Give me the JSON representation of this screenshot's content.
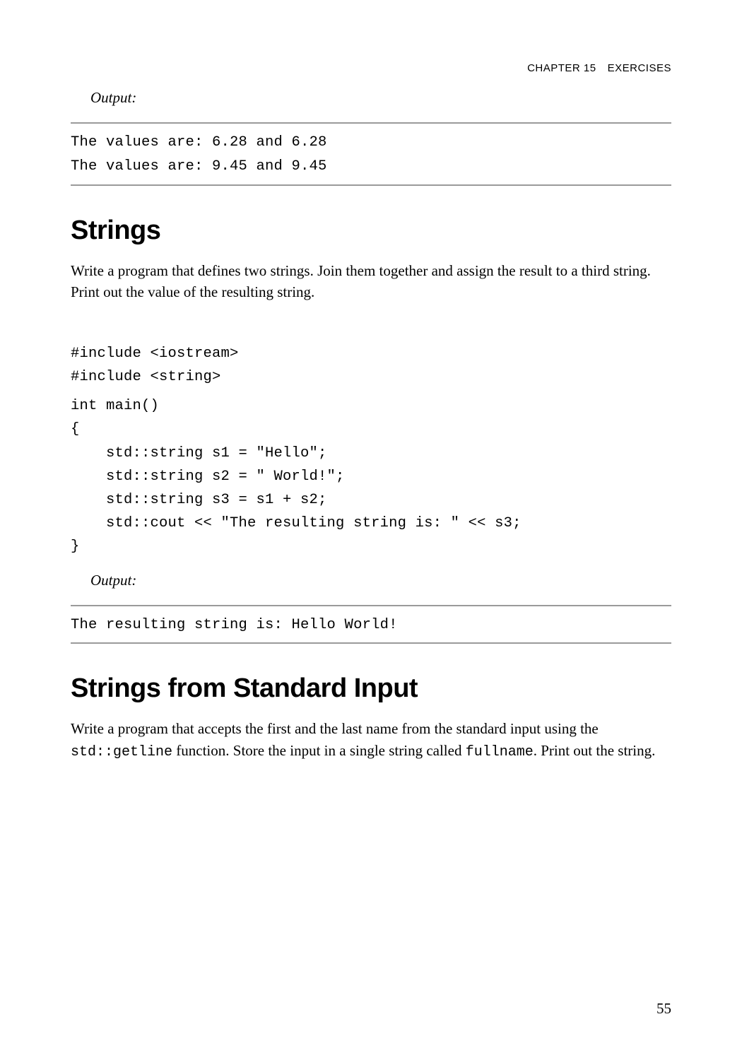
{
  "header": {
    "chapter": "CHAPTER 15",
    "title": "EXERCISES"
  },
  "output1": {
    "label": "Output:",
    "lines": [
      "The values are: 6.28 and 6.28",
      "The values are: 9.45 and 9.45"
    ]
  },
  "section1": {
    "heading": "Strings",
    "description": "Write a program that defines two strings. Join them together and assign the result to a third string. Print out the value of the resulting string.",
    "code": [
      "#include <iostream>",
      "#include <string>",
      "",
      "int main()",
      "{",
      "    std::string s1 = \"Hello\";",
      "    std::string s2 = \" World!\";",
      "    std::string s3 = s1 + s2;",
      "    std::cout << \"The resulting string is: \" << s3;",
      "}"
    ]
  },
  "output2": {
    "label": "Output:",
    "lines": [
      "The resulting string is: Hello World!"
    ]
  },
  "section2": {
    "heading": "Strings from Standard Input",
    "description_pre": "Write a program that accepts the first and the last name from the standard input using the ",
    "inline_code1": "std::getline",
    "description_mid": " function. Store the input in a single string called ",
    "inline_code2": "fullname",
    "description_post": ". Print out the string."
  },
  "page_number": "55"
}
